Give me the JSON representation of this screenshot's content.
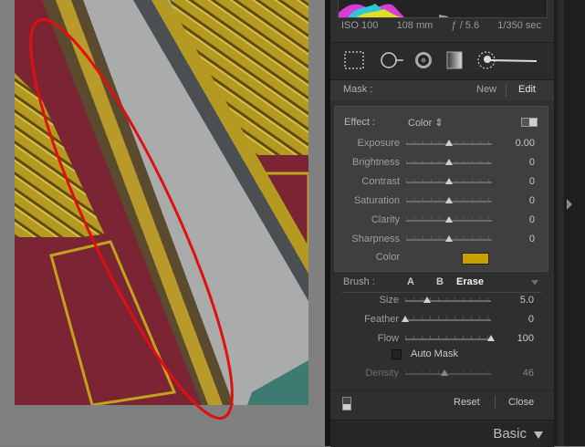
{
  "exif": {
    "iso": "ISO 100",
    "focal": "108 mm",
    "aperture": "ƒ / 5.6",
    "shutter": "1/350 sec"
  },
  "mask": {
    "label": "Mask :",
    "new_label": "New",
    "edit_label": "Edit"
  },
  "effect": {
    "label": "Effect :",
    "value": "Color ⇕",
    "sliders": [
      {
        "label": "Exposure",
        "value": "0.00",
        "level": 0.5
      },
      {
        "label": "Brightness",
        "value": "0",
        "level": 0.5
      },
      {
        "label": "Contrast",
        "value": "0",
        "level": 0.5
      },
      {
        "label": "Saturation",
        "value": "0",
        "level": 0.5
      },
      {
        "label": "Clarity",
        "value": "0",
        "level": 0.5
      },
      {
        "label": "Sharpness",
        "value": "0",
        "level": 0.5
      }
    ],
    "color_label": "Color",
    "color_value": "#c8a000"
  },
  "brush": {
    "label": "Brush :",
    "a_label": "A",
    "b_label": "B",
    "erase_label": "Erase",
    "sliders": [
      {
        "label": "Size",
        "value": "5.0",
        "level": 0.25
      },
      {
        "label": "Feather",
        "value": "0",
        "level": 0.0
      },
      {
        "label": "Flow",
        "value": "100",
        "level": 1.0
      },
      {
        "label": "Density",
        "value": "46",
        "level": 0.46
      }
    ],
    "automask_label": "Auto Mask"
  },
  "footer": {
    "reset_label": "Reset",
    "close_label": "Close"
  },
  "section": {
    "basic_label": "Basic"
  },
  "tools": [
    "crop-overlay-icon",
    "spot-removal-icon",
    "red-eye-icon",
    "graduated-filter-icon",
    "adjustment-brush-icon"
  ],
  "colors": {
    "annotation_red": "#e01010",
    "panel_bg": "#2f2f2f",
    "shutter_yellow": "#c2a31c",
    "frame_maroon": "#7b2433"
  }
}
